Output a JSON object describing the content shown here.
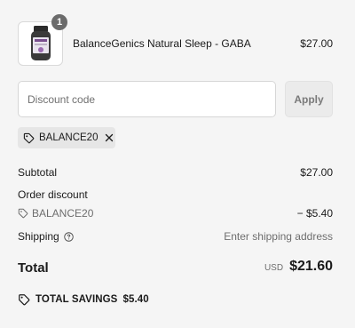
{
  "product": {
    "quantity": "1",
    "name": "BalanceGenics Natural Sleep - GABA",
    "price": "$27.00",
    "image_icon": "supplement-bottle-icon"
  },
  "discount": {
    "placeholder": "Discount code",
    "apply_label": "Apply",
    "applied_code": "BALANCE20"
  },
  "summary": {
    "subtotal_label": "Subtotal",
    "subtotal_value": "$27.00",
    "order_discount_label": "Order discount",
    "discount_code": "BALANCE20",
    "discount_value": "− $5.40",
    "shipping_label": "Shipping",
    "shipping_value": "Enter shipping address",
    "total_label": "Total",
    "currency": "USD",
    "total_value": "$21.60"
  },
  "savings": {
    "label": "TOTAL SAVINGS",
    "amount": "$5.40"
  },
  "colors": {
    "background": "#f5f5f5",
    "chip": "#e6e6e6",
    "badge": "#6b6b6b",
    "muted_text": "#6e6e6e"
  }
}
